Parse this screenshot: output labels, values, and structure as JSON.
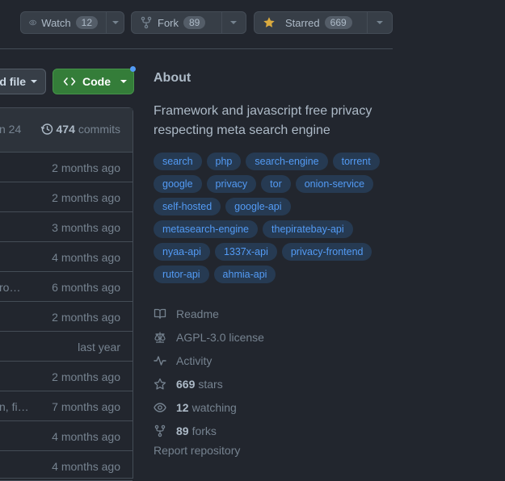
{
  "header": {
    "watch": {
      "label": "Watch",
      "count": "12"
    },
    "fork": {
      "label": "Fork",
      "count": "89"
    },
    "star": {
      "label": "Starred",
      "count": "669"
    }
  },
  "repo_actions": {
    "add_file_label": "d file",
    "code_label": "Code"
  },
  "file_list": {
    "head_left": "n 24",
    "commits_count": "474",
    "commits_label": "commits",
    "rows": [
      {
        "msg": "",
        "time": "2 months ago"
      },
      {
        "msg": "",
        "time": "2 months ago"
      },
      {
        "msg": "",
        "time": "3 months ago"
      },
      {
        "msg": "",
        "time": "4 months ago"
      },
      {
        "msg": "ro…",
        "time": "6 months ago"
      },
      {
        "msg": "",
        "time": "2 months ago"
      },
      {
        "msg": "",
        "time": "last year"
      },
      {
        "msg": "",
        "time": "2 months ago"
      },
      {
        "msg": "n, fi…",
        "time": "7 months ago"
      },
      {
        "msg": "",
        "time": "4 months ago"
      },
      {
        "msg": "",
        "time": "4 months ago"
      }
    ]
  },
  "about": {
    "title": "About",
    "description": "Framework and javascript free privacy respecting meta search engine",
    "topics": [
      "search",
      "php",
      "search-engine",
      "torrent",
      "google",
      "privacy",
      "tor",
      "onion-service",
      "self-hosted",
      "google-api",
      "metasearch-engine",
      "thepiratebay-api",
      "nyaa-api",
      "1337x-api",
      "privacy-frontend",
      "rutor-api",
      "ahmia-api"
    ],
    "readme": "Readme",
    "license": "AGPL-3.0 license",
    "activity": "Activity",
    "stars_count": "669",
    "stars_label": "stars",
    "watching_count": "12",
    "watching_label": "watching",
    "forks_count": "89",
    "forks_label": "forks",
    "report": "Report repository"
  },
  "colors": {
    "background": "#22262e",
    "accent_green": "#347d39",
    "topic_bg": "#263a52",
    "topic_text": "#539bf5",
    "star_yellow": "#daaa3f"
  }
}
